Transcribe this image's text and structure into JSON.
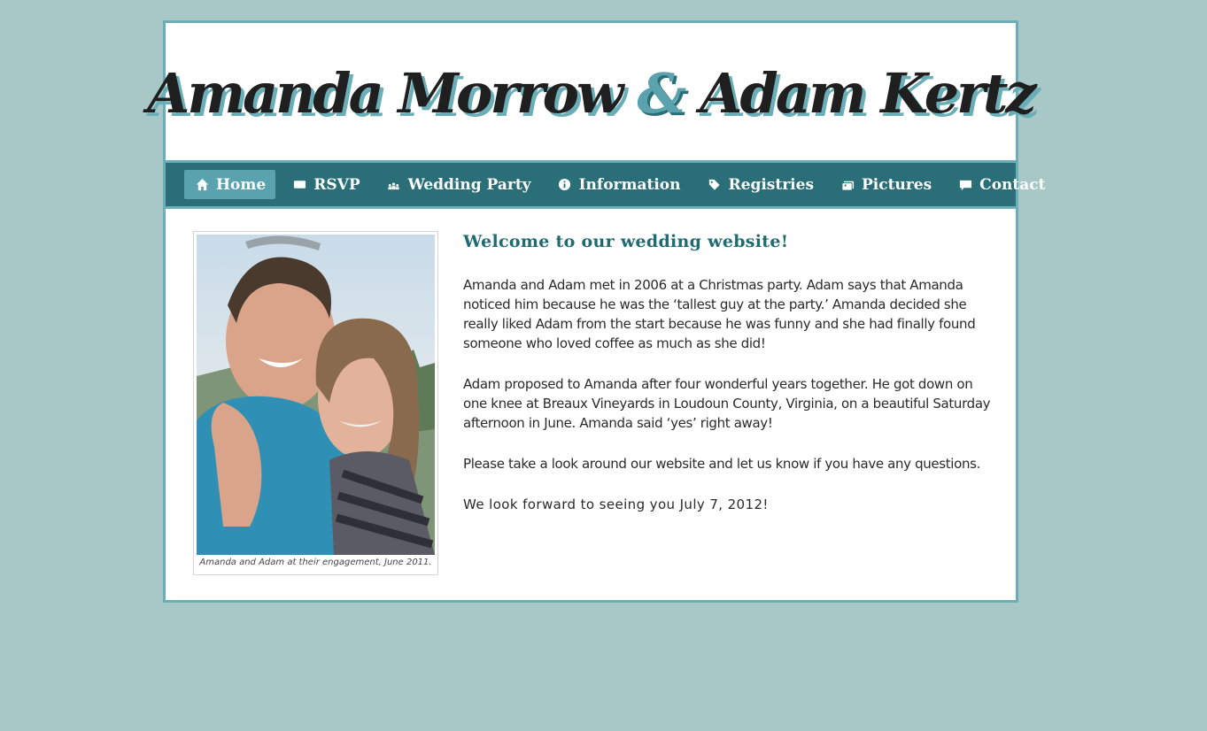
{
  "header": {
    "name_one": "Amanda Morrow",
    "ampersand": "&",
    "name_two": "Adam Kertz"
  },
  "nav": {
    "items": [
      {
        "label": "Home",
        "icon": "home-icon",
        "active": true
      },
      {
        "label": "RSVP",
        "icon": "envelope-icon",
        "active": false
      },
      {
        "label": "Wedding Party",
        "icon": "people-icon",
        "active": false
      },
      {
        "label": "Information",
        "icon": "info-icon",
        "active": false
      },
      {
        "label": "Registries",
        "icon": "tag-icon",
        "active": false
      },
      {
        "label": "Pictures",
        "icon": "photos-icon",
        "active": false
      },
      {
        "label": "Contact",
        "icon": "speech-bubble-icon",
        "active": false
      }
    ]
  },
  "photo": {
    "caption": "Amanda and Adam at their engagement, June 2011."
  },
  "main": {
    "heading": "Welcome to our wedding website!",
    "paragraphs": [
      "Amanda and Adam met in 2006 at a Christmas party. Adam says that Amanda noticed him because he was the ‘tallest guy at the party.’ Amanda decided she really liked Adam from the start because he was funny and she had finally found someone who loved coffee as much as she did!",
      "Adam proposed to Amanda after four wonderful years together. He got down on one knee at Breaux Vineyards in Loudoun County, Virginia, on a beautiful Saturday afternoon in June. Amanda said ‘yes’ right away!",
      "Please take a look around our website and let us know if you have any questions.",
      "We look forward to seeing you July 7, 2012!"
    ]
  },
  "colors": {
    "page_background": "#a7c8c7",
    "frame_border": "#6aaeb8",
    "nav_background": "#2a6f78",
    "nav_active": "#5aa3ae",
    "heading": "#1e6b72"
  }
}
